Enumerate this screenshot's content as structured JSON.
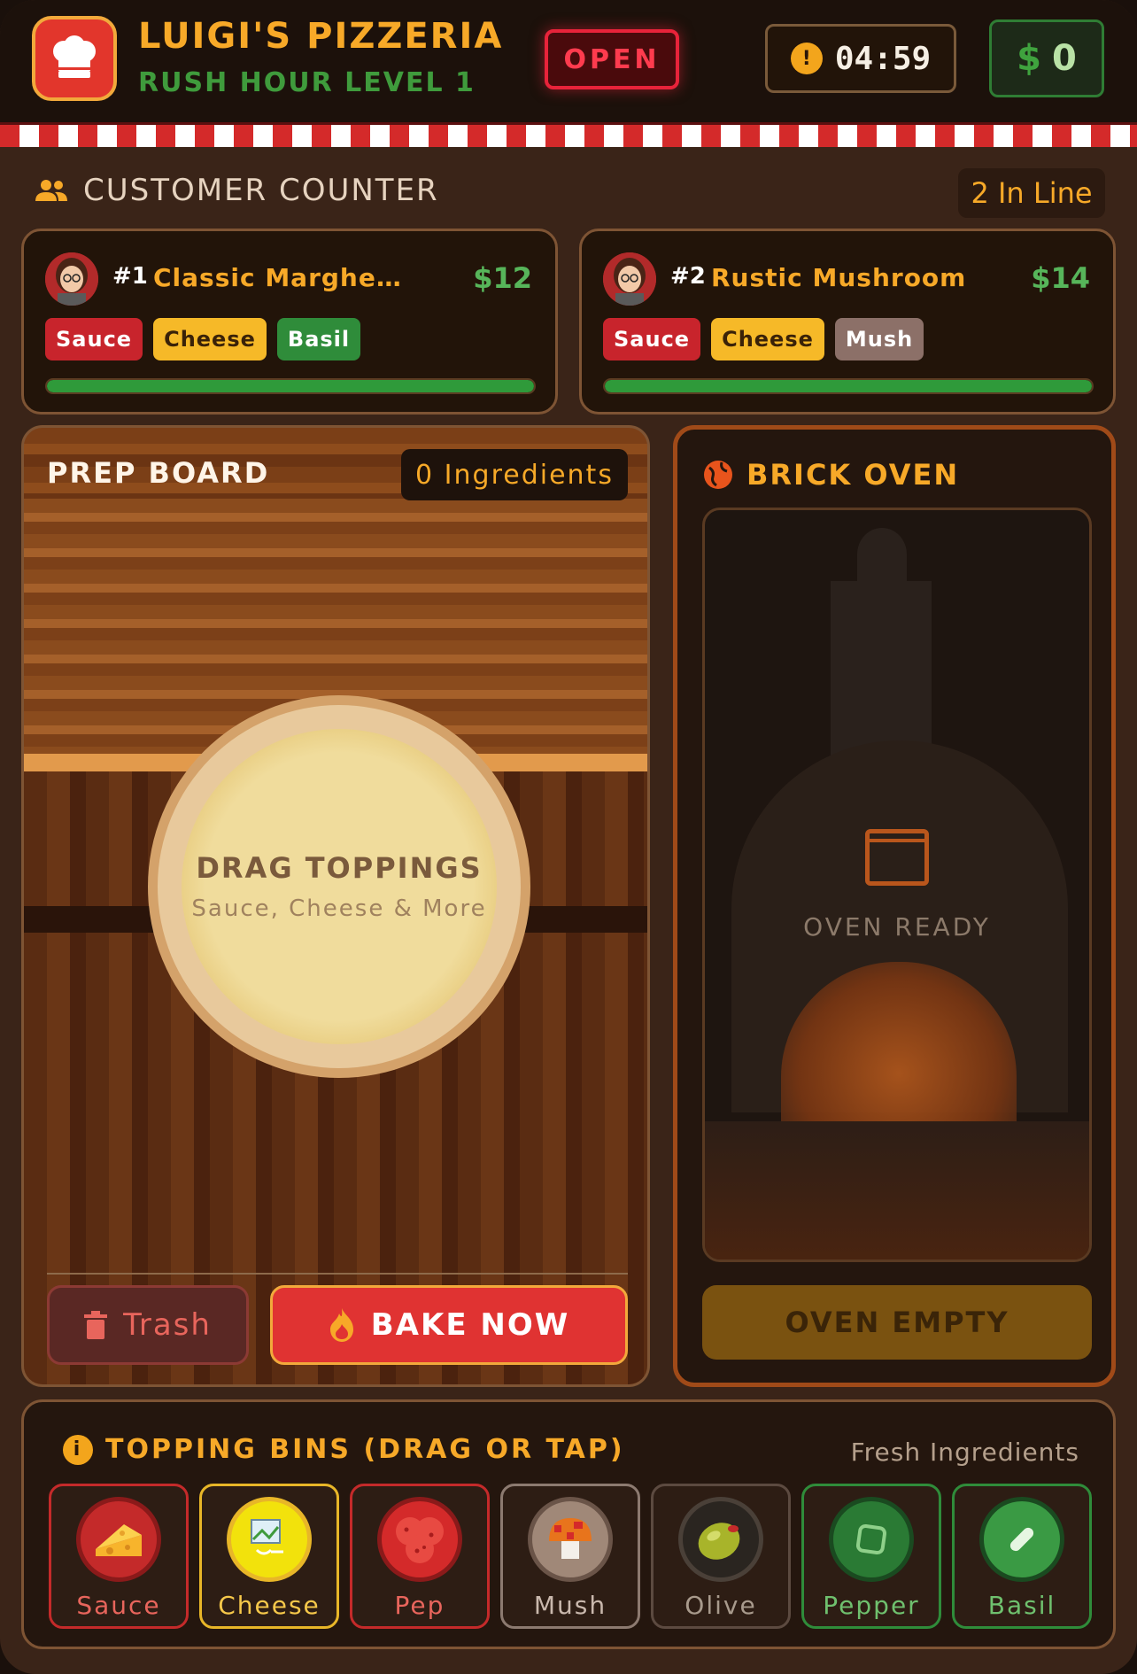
{
  "header": {
    "title": "LUIGI'S PIZZERIA",
    "subtitle": "RUSH HOUR LEVEL 1",
    "open_label": "OPEN",
    "timer": "04:59",
    "money_symbol": "$",
    "money_value": "0",
    "logo_icon": "chef-hat-icon"
  },
  "customers": {
    "title": "CUSTOMER COUNTER",
    "in_line": "2 In Line",
    "orders": [
      {
        "num": "#1",
        "name": "Classic Margher...",
        "price": "$12",
        "toppings": [
          "Sauce",
          "Cheese",
          "Basil"
        ],
        "patience": 1.0
      },
      {
        "num": "#2",
        "name": "Rustic Mushroom",
        "price": "$14",
        "toppings": [
          "Sauce",
          "Cheese",
          "Mush"
        ],
        "patience": 1.0
      }
    ]
  },
  "prep": {
    "title": "PREP BOARD",
    "ingredients": "0 Ingredients",
    "drag_main": "DRAG TOPPINGS",
    "drag_sub": "Sauce, Cheese & More",
    "trash_label": "Trash",
    "bake_label": "BAKE NOW"
  },
  "oven": {
    "title": "BRICK OVEN",
    "status": "OVEN READY",
    "button": "OVEN EMPTY"
  },
  "bins": {
    "title": "TOPPING BINS (DRAG OR TAP)",
    "note": "Fresh Ingredients",
    "items": [
      {
        "label": "Sauce",
        "icon": "cheese-wedge-icon",
        "color": "#c42a2a"
      },
      {
        "label": "Cheese",
        "icon": "broken-image-icon",
        "color": "#e8b628"
      },
      {
        "label": "Pep",
        "icon": "pepperoni-icon",
        "color": "#c42a2a"
      },
      {
        "label": "Mush",
        "icon": "mushroom-icon",
        "color": "#8c7a70"
      },
      {
        "label": "Olive",
        "icon": "olive-icon",
        "color": "#5c4a40"
      },
      {
        "label": "Pepper",
        "icon": "pepper-icon",
        "color": "#2f8c3a"
      },
      {
        "label": "Basil",
        "icon": "basil-leaf-icon",
        "color": "#2f8c3a"
      }
    ]
  },
  "colors": {
    "accent": "#f7a928",
    "danger": "#e03332",
    "success": "#2f9a3a"
  }
}
